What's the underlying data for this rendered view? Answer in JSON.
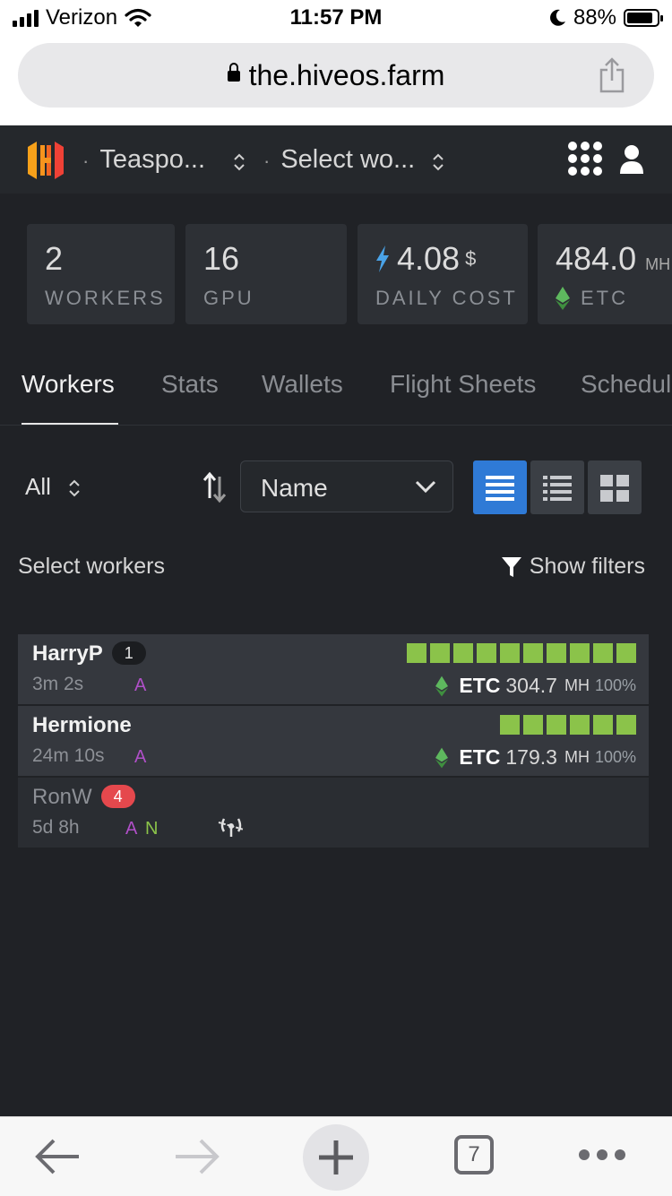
{
  "status_bar": {
    "carrier": "Verizon",
    "time": "11:57 PM",
    "battery": "88%",
    "battery_level": 0.88
  },
  "browser": {
    "url": "the.hiveos.farm",
    "tabs_count": "7"
  },
  "header": {
    "farm": "Teaspo...",
    "worker_select": "Select wo...",
    "separator": "·"
  },
  "stats": {
    "workers": {
      "value": "2",
      "label": "WORKERS"
    },
    "gpu": {
      "value": "16",
      "label": "GPU"
    },
    "daily_cost": {
      "value": "4.08",
      "unit": "$",
      "label": "DAILY COST"
    },
    "hashrate": {
      "value": "484.0",
      "unit": "MH",
      "label": "ETC"
    }
  },
  "tabs": [
    {
      "label": "Workers",
      "active": true
    },
    {
      "label": "Stats"
    },
    {
      "label": "Wallets"
    },
    {
      "label": "Flight Sheets"
    },
    {
      "label": "Schedul"
    }
  ],
  "controls": {
    "filter_all": "All",
    "sort_by": "Name",
    "select_workers": "Select workers",
    "show_filters": "Show filters"
  },
  "workers": [
    {
      "name": "HarryP",
      "badge": "1",
      "uptime": "3m 2s",
      "flags": [
        "A"
      ],
      "gpus_ok": 10,
      "coin": "ETC",
      "hashrate": "304.7",
      "unit": "MH",
      "percent": "100%"
    },
    {
      "name": "Hermione",
      "badge": "",
      "uptime": "24m 10s",
      "flags": [
        "A"
      ],
      "gpus_ok": 6,
      "coin": "ETC",
      "hashrate": "179.3",
      "unit": "MH",
      "percent": "100%"
    },
    {
      "name": "RonW",
      "badge": "4",
      "uptime": "5d 8h",
      "flags": [
        "A",
        "N"
      ],
      "offline": true
    }
  ],
  "colors": {
    "accent": "#2f7ad6",
    "gpu_ok": "#8bc34a",
    "flag_a": "#b04fc8",
    "flag_n": "#8bc34a",
    "badge_alert": "#e5484d",
    "eth": "#5eb85e",
    "bolt": "#4aa3e8"
  }
}
